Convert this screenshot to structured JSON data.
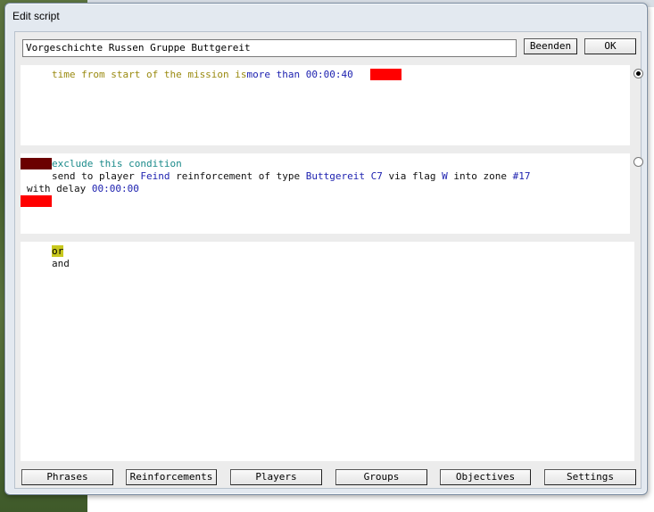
{
  "window": {
    "title": "Edit script"
  },
  "header": {
    "script_name": "Vorgeschichte Russen Gruppe Buttgereit",
    "end_label": "Beenden",
    "ok_label": "OK"
  },
  "condition_pane": {
    "selected": true,
    "text_prefix": "time from start of the mission is",
    "operator": "more than",
    "time_value": "00:00:40"
  },
  "action_pane": {
    "selected": false,
    "exclude_label": "exclude this condition",
    "line1_send": "send to player ",
    "player": "Feind",
    "line1_mid": " reinforcement of type ",
    "unit": "Buttgereit C7",
    "line1_via": " via flag ",
    "flag": "W",
    "line1_zone": " into zone ",
    "zone": "#17",
    "line2_delay": "with delay ",
    "delay_value": "00:00:00"
  },
  "logic_pane": {
    "options": [
      "or",
      "and"
    ],
    "selected": "or"
  },
  "tabs": [
    {
      "label": "Phrases"
    },
    {
      "label": "Reinforcements"
    },
    {
      "label": "Players"
    },
    {
      "label": "Groups"
    },
    {
      "label": "Objectives"
    },
    {
      "label": "Settings"
    }
  ],
  "colors": {
    "keyword_olive": "#9a8a10",
    "value_blue": "#1e22b0",
    "exclude_teal": "#1a8a8a",
    "marker_red": "#ff0000",
    "marker_dark_red": "#6b0000",
    "or_highlight": "#c8c81e"
  }
}
